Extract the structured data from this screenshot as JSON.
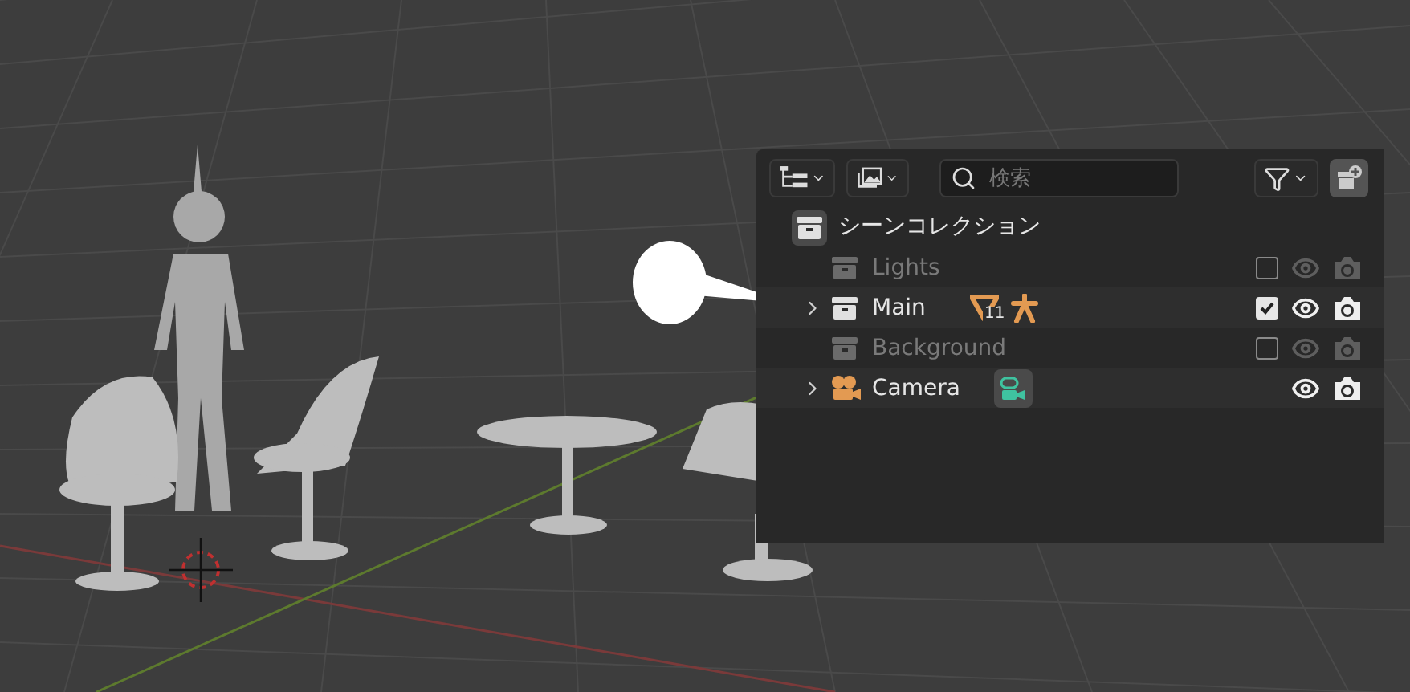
{
  "outliner": {
    "toolbar": {
      "search": {
        "placeholder": "検索"
      }
    },
    "root": {
      "label": "シーンコレクション"
    },
    "items": [
      {
        "label": "Lights",
        "kind": "collection",
        "expandable": false,
        "checked": false
      },
      {
        "label": "Main",
        "kind": "collection",
        "expandable": true,
        "checked": true,
        "badges": [
          {
            "kind": "mesh",
            "count": "11"
          },
          {
            "kind": "armature"
          }
        ]
      },
      {
        "label": "Background",
        "kind": "collection",
        "expandable": false,
        "checked": false
      },
      {
        "label": "Camera",
        "kind": "camera",
        "expandable": true,
        "badges": [
          {
            "kind": "camera_data"
          }
        ]
      }
    ]
  }
}
